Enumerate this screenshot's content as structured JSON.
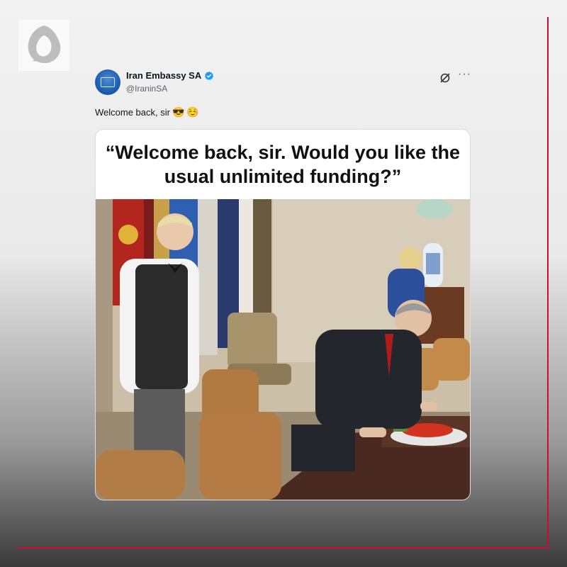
{
  "tweet": {
    "display_name": "Iran Embassy SA",
    "handle": "@IraninSA",
    "text": "Welcome back, sir",
    "emojis": [
      "😎",
      "☺️"
    ],
    "verified": true
  },
  "meme": {
    "caption": "“Welcome back, sir. Would you like the usual unlimited funding?”"
  },
  "icons": {
    "verified": "verified-badge-icon",
    "grok": "grok-icon",
    "more": "more-options-icon",
    "logo": "channel-logo-icon"
  },
  "colors": {
    "verified_blue": "#1d9bf0",
    "frame_red": "#c8102e",
    "handle_gray": "#536471"
  }
}
